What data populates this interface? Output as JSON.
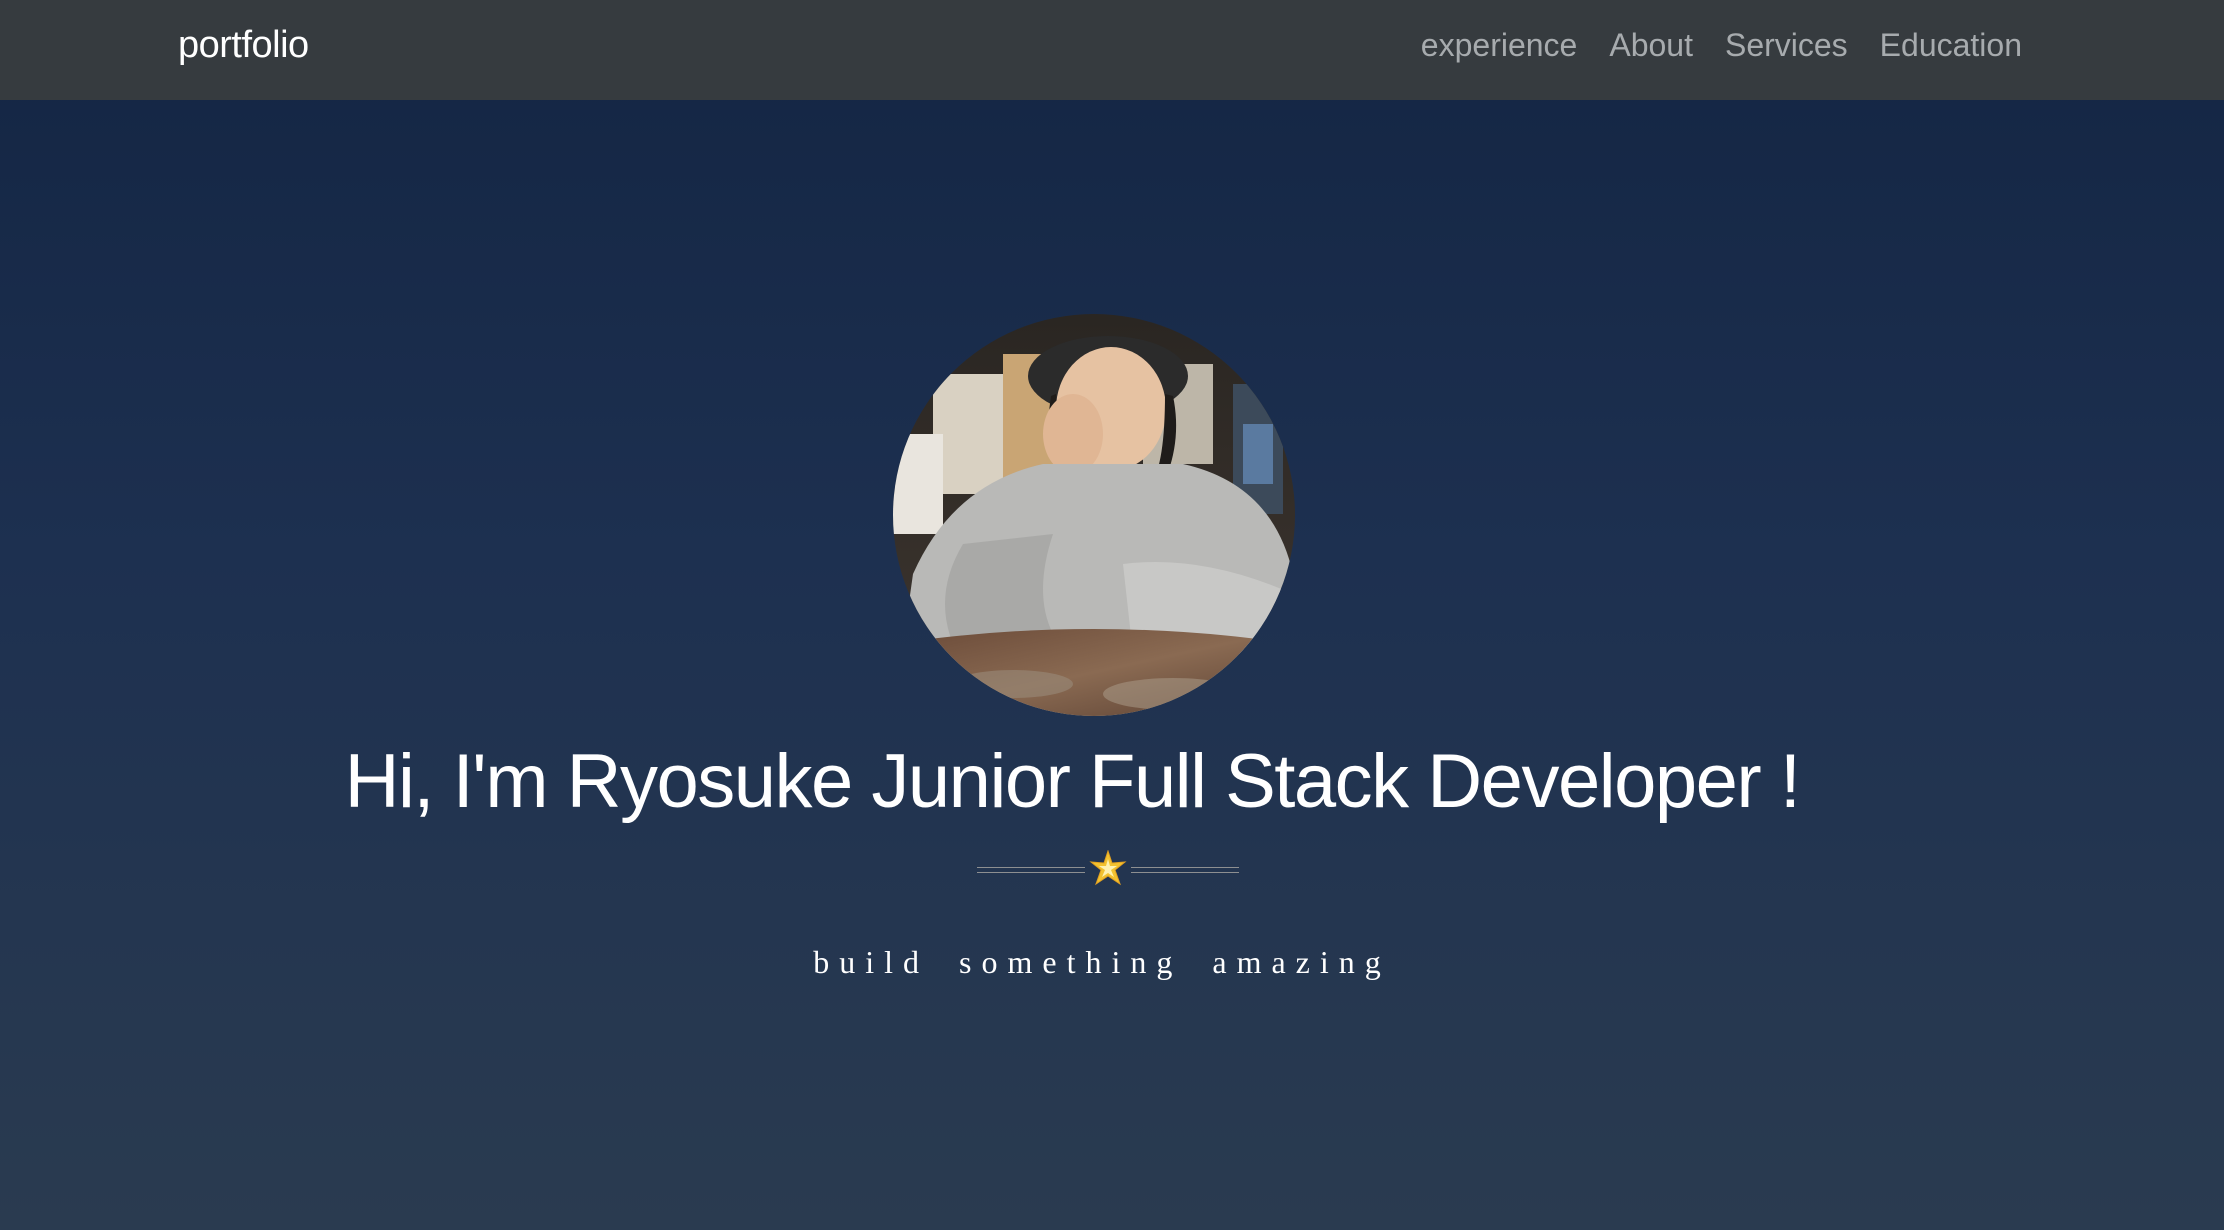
{
  "navbar": {
    "brand": "portfolio",
    "links": [
      {
        "label": "experience"
      },
      {
        "label": "About"
      },
      {
        "label": "Services"
      },
      {
        "label": "Education"
      }
    ]
  },
  "hero": {
    "headline": "Hi, I'm Ryosuke Junior Full Stack Developer !",
    "divider_icon": "star-icon",
    "tagline": "build something amazing"
  },
  "colors": {
    "navbar_bg": "#363b3f",
    "hero_bg_top": "#132543",
    "hero_bg_bottom": "#2a3b50",
    "nav_link": "#a7abae",
    "text": "#ffffff"
  }
}
